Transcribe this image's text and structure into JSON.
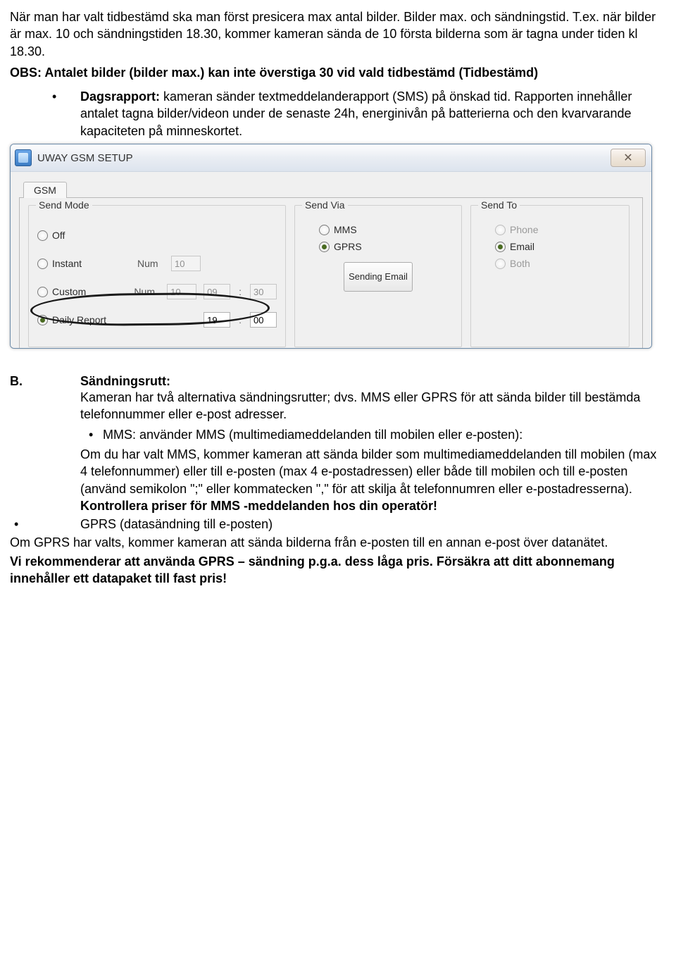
{
  "p1": "När man har valt tidbestämd ska man först presicera max antal bilder. Bilder max. och sändningstid. T.ex. när bilder är max. 10 och sändningstiden 18.30, kommer kameran sända de 10 första bilderna som är tagna under tiden kl 18.30.",
  "p2a": "OBS: Antalet bilder (bilder max.) kan inte överstiga 30 vid vald tidbestämd (Tidbestämd)",
  "dagsrapport_label": "Dagsrapport:",
  "dagsrapport_text": " kameran sänder textmeddelanderapport (SMS) på önskad tid. Rapporten innehåller antalet tagna bilder/videon under de senaste 24h, energinivån på batterierna och den kvarvarande kapaciteten på minneskortet.",
  "window": {
    "title": "UWAY GSM SETUP",
    "close": "✕",
    "tab": "GSM",
    "groups": {
      "send_mode": {
        "legend": "Send Mode",
        "off": "Off",
        "instant": "Instant",
        "custom": "Custom",
        "daily": "Daily Report",
        "num": "Num",
        "instant_num": "10",
        "custom_num": "10",
        "custom_h": "09",
        "custom_m": "30",
        "daily_h": "19",
        "daily_m": "00"
      },
      "send_via": {
        "legend": "Send Via",
        "mms": "MMS",
        "gprs": "GPRS",
        "sending_email": "Sending Email"
      },
      "send_to": {
        "legend": "Send To",
        "phone": "Phone",
        "email": "Email",
        "both": "Both"
      }
    }
  },
  "sectionB": {
    "letter": "B.",
    "title": "Sändningsrutt:",
    "intro": "Kameran har två alternativa sändningsrutter; dvs. MMS eller GPRS för   att sända bilder till bestämda telefonnummer eller e-post adresser.",
    "mms_header": "MMS: använder MMS (multimediameddelanden till mobilen eller e-posten):",
    "mms_body_a": "Om du har valt MMS, kommer kameran att sända bilder som multimediameddelanden till mobilen (max 4 telefonnummer) eller till e-posten (max 4 e-postadressen) eller både till mobilen och till e-posten (använd semikolon \";\" eller kommatecken \",\" för att skilja åt telefonnumren eller e-postadresserna). ",
    "mms_body_b": "Kontrollera priser för MMS -meddelanden hos din operatör!",
    "gprs_header": "GPRS (datasändning till e-posten)",
    "gprs_body": "Om GPRS har valts, kommer kameran att sända bilderna från e-posten till en annan e-post över datanätet.",
    "rec_a": "Vi rekommenderar att använda GPRS – sändning p.g.a. dess låga pris. ",
    "rec_b": "Försäkra att ditt abonnemang innehåller ett datapaket till fast pris!"
  }
}
